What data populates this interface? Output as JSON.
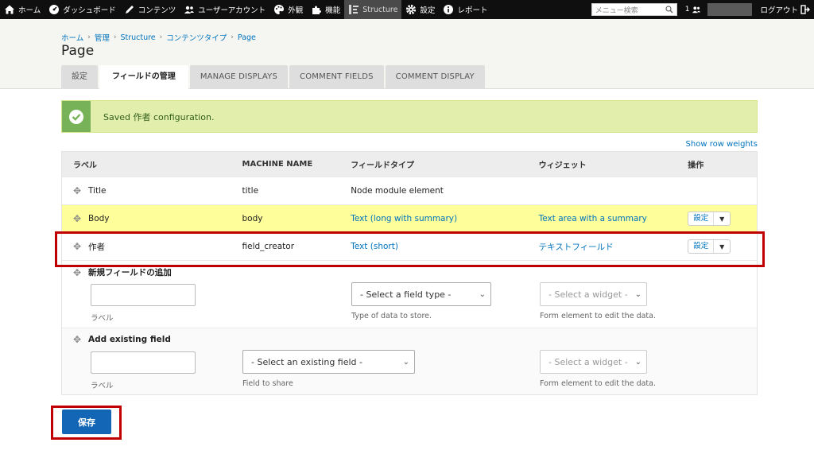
{
  "toolbar": {
    "items": [
      {
        "label": "ホーム",
        "icon": "home-icon"
      },
      {
        "label": "ダッシュボード",
        "icon": "dashboard-icon"
      },
      {
        "label": "コンテンツ",
        "icon": "pencil-icon"
      },
      {
        "label": "ユーザーアカウント",
        "icon": "users-icon"
      },
      {
        "label": "外観",
        "icon": "palette-icon"
      },
      {
        "label": "機能",
        "icon": "puzzle-icon"
      },
      {
        "label": "Structure",
        "icon": "structure-icon"
      },
      {
        "label": "設定",
        "icon": "gear-icon"
      },
      {
        "label": "レポート",
        "icon": "info-icon"
      }
    ],
    "search_placeholder": "メニュー検索",
    "user_count": "1",
    "logout": "ログアウト"
  },
  "breadcrumb": [
    "ホーム",
    "管理",
    "Structure",
    "コンテンツタイプ",
    "Page"
  ],
  "page_title": "Page",
  "tabs": [
    "設定",
    "フィールドの管理",
    "MANAGE DISPLAYS",
    "COMMENT FIELDS",
    "COMMENT DISPLAY"
  ],
  "message": "Saved 作者 configuration.",
  "show_row_weights": "Show row weights",
  "table": {
    "headers": [
      "ラベル",
      "MACHINE NAME",
      "フィールドタイプ",
      "ウィジェット",
      "操作"
    ],
    "rows": [
      {
        "label": "Title",
        "machine": "title",
        "type": "Node module element",
        "widget": "",
        "op": ""
      },
      {
        "label": "Body",
        "machine": "body",
        "type": "Text (long with summary)",
        "widget": "Text area with a summary",
        "op": "設定"
      },
      {
        "label": "作者",
        "machine": "field_creator",
        "type": "Text (short)",
        "widget": "テキストフィールド",
        "op": "設定"
      }
    ]
  },
  "add_new": {
    "title": "新規フィールドの追加",
    "label_desc": "ラベル",
    "type_select": "- Select a field type -",
    "type_desc": "Type of data to store.",
    "widget_select": "- Select a widget -",
    "widget_desc": "Form element to edit the data."
  },
  "add_existing": {
    "title": "Add existing field",
    "label_desc": "ラベル",
    "field_select": "- Select an existing field -",
    "field_desc": "Field to share",
    "widget_select": "- Select a widget -",
    "widget_desc": "Form element to edit the data."
  },
  "save_button": "保存",
  "colors": {
    "toolbar": "#0f0f0f",
    "accent": "#0074bd",
    "message_bg": "#e2eeab",
    "highlight_row": "#fefe9b",
    "save": "#1366b6",
    "annotation": "#c00000"
  }
}
